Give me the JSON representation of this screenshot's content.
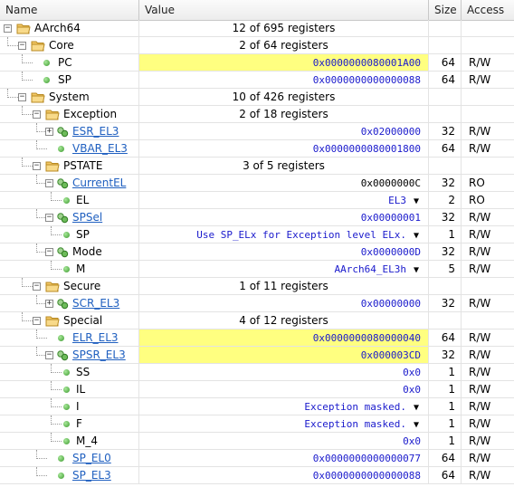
{
  "header": {
    "name": "Name",
    "value": "Value",
    "size": "Size",
    "access": "Access"
  },
  "rows": [
    {
      "id": "aarch64",
      "label": "AArch64",
      "level": 0,
      "type": "group",
      "expanded": true,
      "value": "12 of 695 registers",
      "size": "",
      "access": ""
    },
    {
      "id": "core",
      "label": "Core",
      "level": 1,
      "type": "group",
      "expanded": true,
      "value": "2 of 64 registers",
      "size": "",
      "access": ""
    },
    {
      "id": "pc",
      "label": "PC",
      "level": 2,
      "type": "reg",
      "value": "0x0000000080001A00",
      "size": "64",
      "access": "R/W",
      "highlight": true
    },
    {
      "id": "sp",
      "label": "SP",
      "level": 2,
      "type": "reg",
      "value": "0x0000000000000088",
      "size": "64",
      "access": "R/W"
    },
    {
      "id": "system",
      "label": "System",
      "level": 1,
      "type": "group",
      "expanded": true,
      "value": "10 of 426 registers",
      "size": "",
      "access": ""
    },
    {
      "id": "exception",
      "label": "Exception",
      "level": 2,
      "type": "group",
      "expanded": true,
      "value": "2 of 18 registers",
      "size": "",
      "access": ""
    },
    {
      "id": "esr_el3",
      "label": "ESR_EL3",
      "level": 3,
      "type": "reg",
      "expander": "+",
      "link": true,
      "value": "0x02000000",
      "size": "32",
      "access": "R/W"
    },
    {
      "id": "vbar_el3",
      "label": "VBAR_EL3",
      "level": 3,
      "type": "reg",
      "link": true,
      "value": "0x0000000080001800",
      "size": "64",
      "access": "R/W"
    },
    {
      "id": "pstate",
      "label": "PSTATE",
      "level": 2,
      "type": "group",
      "expanded": true,
      "value": "3 of 5 registers",
      "size": "",
      "access": ""
    },
    {
      "id": "currentel",
      "label": "CurrentEL",
      "level": 3,
      "type": "reg",
      "expander": "-",
      "link": true,
      "value": "0x0000000C",
      "black": true,
      "size": "32",
      "access": "RO"
    },
    {
      "id": "el",
      "label": "EL",
      "level": 4,
      "type": "field",
      "value": "EL3",
      "dropdown": true,
      "size": "2",
      "access": "RO"
    },
    {
      "id": "spsel",
      "label": "SPSel",
      "level": 3,
      "type": "reg",
      "expander": "-",
      "link": true,
      "value": "0x00000001",
      "size": "32",
      "access": "R/W"
    },
    {
      "id": "sp_field",
      "label": "SP",
      "level": 4,
      "type": "field",
      "value": "Use SP_ELx for Exception level ELx.",
      "dropdown": true,
      "size": "1",
      "access": "R/W"
    },
    {
      "id": "mode",
      "label": "Mode",
      "level": 3,
      "type": "reg",
      "expander": "-",
      "value": "0x0000000D",
      "size": "32",
      "access": "R/W"
    },
    {
      "id": "m",
      "label": "M",
      "level": 4,
      "type": "field",
      "value": "AArch64_EL3h",
      "dropdown": true,
      "size": "5",
      "access": "R/W"
    },
    {
      "id": "secure",
      "label": "Secure",
      "level": 2,
      "type": "group",
      "expanded": true,
      "value": "1 of 11 registers",
      "size": "",
      "access": ""
    },
    {
      "id": "scr_el3",
      "label": "SCR_EL3",
      "level": 3,
      "type": "reg",
      "expander": "+",
      "link": true,
      "value": "0x00000000",
      "size": "32",
      "access": "R/W"
    },
    {
      "id": "special",
      "label": "Special",
      "level": 2,
      "type": "group",
      "expanded": true,
      "value": "4 of 12 registers",
      "size": "",
      "access": ""
    },
    {
      "id": "elr_el3",
      "label": "ELR_EL3",
      "level": 3,
      "type": "reg",
      "link": true,
      "value": "0x0000000080000040",
      "size": "64",
      "access": "R/W",
      "highlight": true
    },
    {
      "id": "spsr_el3",
      "label": "SPSR_EL3",
      "level": 3,
      "type": "reg",
      "expander": "-",
      "link": true,
      "value": "0x000003CD",
      "size": "32",
      "access": "R/W",
      "highlight": true
    },
    {
      "id": "ss",
      "label": "SS",
      "level": 4,
      "type": "field",
      "value": "0x0",
      "size": "1",
      "access": "R/W"
    },
    {
      "id": "il",
      "label": "IL",
      "level": 4,
      "type": "field",
      "value": "0x0",
      "size": "1",
      "access": "R/W"
    },
    {
      "id": "i",
      "label": "I",
      "level": 4,
      "type": "field",
      "value": "Exception masked.",
      "dropdown": true,
      "size": "1",
      "access": "R/W"
    },
    {
      "id": "f",
      "label": "F",
      "level": 4,
      "type": "field",
      "value": "Exception masked.",
      "dropdown": true,
      "size": "1",
      "access": "R/W"
    },
    {
      "id": "m_4",
      "label": "M_4",
      "level": 4,
      "type": "field",
      "value": "0x0",
      "size": "1",
      "access": "R/W"
    },
    {
      "id": "sp_el0",
      "label": "SP_EL0",
      "level": 3,
      "type": "reg",
      "link": true,
      "value": "0x0000000000000077",
      "size": "64",
      "access": "R/W"
    },
    {
      "id": "sp_el3",
      "label": "SP_EL3",
      "level": 3,
      "type": "reg",
      "link": true,
      "value": "0x0000000000000088",
      "size": "64",
      "access": "R/W"
    }
  ],
  "colors": {
    "highlight": "#ffff80",
    "value_text": "#1a1acc",
    "link": "#2060c0"
  }
}
